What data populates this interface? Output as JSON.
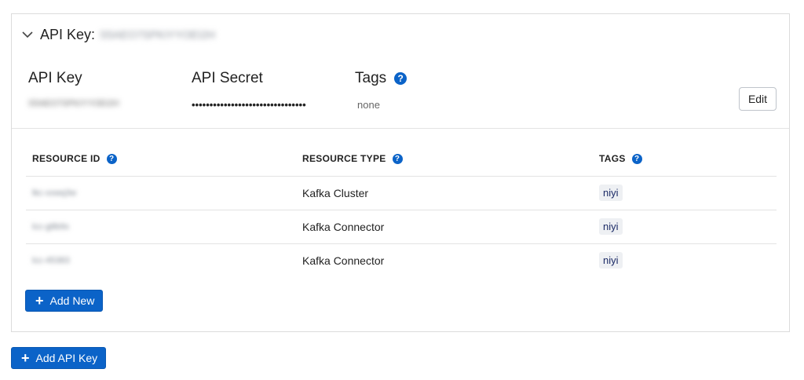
{
  "key_card": {
    "title": "API Key:",
    "title_key_value": "S5AEO7SPKIYYOEI2H",
    "api_key_label": "API Key",
    "api_key_value": "S5AEO7SPKIYYOEI2H",
    "api_secret_label": "API Secret",
    "api_secret_value": "••••••••••••••••••••••••••••••••",
    "tags_label": "Tags",
    "tags_value": "none",
    "edit_label": "Edit"
  },
  "table": {
    "headers": [
      "RESOURCE ID",
      "RESOURCE TYPE",
      "TAGS"
    ],
    "rows": [
      {
        "id": "lkc-xxwq3w",
        "type": "Kafka Cluster",
        "tag": "niyi"
      },
      {
        "id": "lcc-g8b9x",
        "type": "Kafka Connector",
        "tag": "niyi"
      },
      {
        "id": "lcc-45383",
        "type": "Kafka Connector",
        "tag": "niyi"
      }
    ]
  },
  "buttons": {
    "add_new": "Add New",
    "add_api_key": "Add API Key"
  },
  "colors": {
    "primary": "#0b63c8",
    "tag_bg": "#eef0f3",
    "tag_text": "#1b2a66"
  }
}
